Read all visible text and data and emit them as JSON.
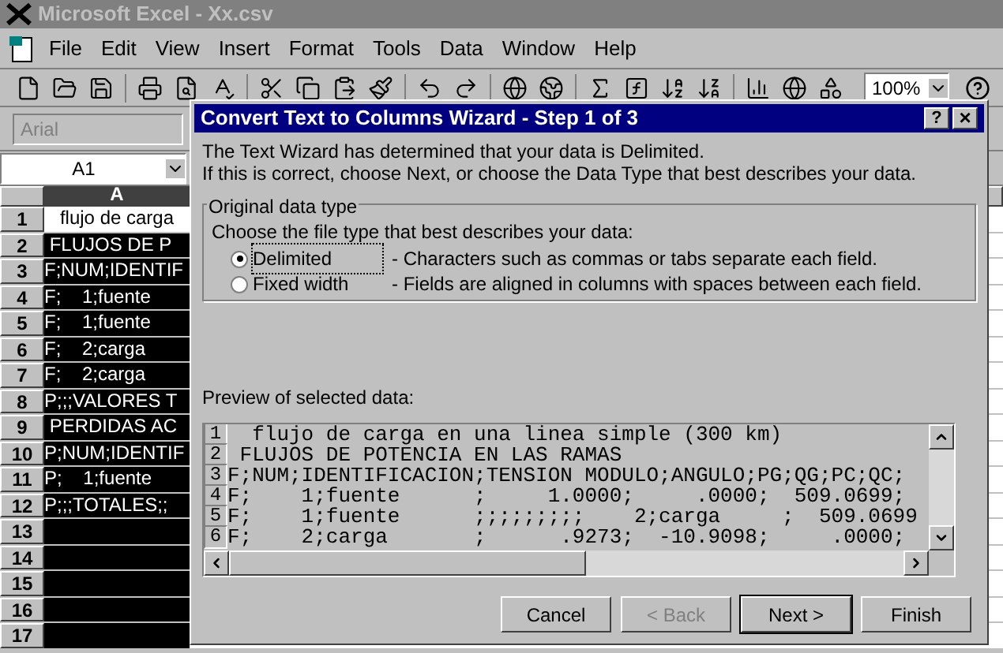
{
  "window": {
    "title": "Microsoft Excel - Xx.csv",
    "active": false
  },
  "menu": [
    "File",
    "Edit",
    "View",
    "Insert",
    "Format",
    "Tools",
    "Data",
    "Window",
    "Help"
  ],
  "toolbar": {
    "zoom": "100%"
  },
  "format_toolbar": {
    "font": "Arial"
  },
  "formula_bar": {
    "name_box": "A1"
  },
  "sheet": {
    "columns": [
      {
        "label": "A",
        "selected": true
      }
    ],
    "rows": [
      {
        "number": "1",
        "cell": "flujo de carga",
        "active": true
      },
      {
        "number": "2",
        "cell": " FLUJOS DE P",
        "active": false
      },
      {
        "number": "3",
        "cell": "F;NUM;IDENTIF",
        "active": false
      },
      {
        "number": "4",
        "cell": "F;    1;fuente",
        "active": false
      },
      {
        "number": "5",
        "cell": "F;    1;fuente",
        "active": false
      },
      {
        "number": "6",
        "cell": "F;    2;carga",
        "active": false
      },
      {
        "number": "7",
        "cell": "F;    2;carga",
        "active": false
      },
      {
        "number": "8",
        "cell": "P;;;VALORES T",
        "active": false
      },
      {
        "number": "9",
        "cell": " PERDIDAS AC",
        "active": false
      },
      {
        "number": "10",
        "cell": "P;NUM;IDENTIF",
        "active": false
      },
      {
        "number": "11",
        "cell": "P;    1;fuente",
        "active": false
      },
      {
        "number": "12",
        "cell": "P;;;TOTALES;;",
        "active": false
      },
      {
        "number": "13",
        "cell": "",
        "active": false
      },
      {
        "number": "14",
        "cell": "",
        "active": false
      },
      {
        "number": "15",
        "cell": "",
        "active": false
      },
      {
        "number": "16",
        "cell": "",
        "active": false
      },
      {
        "number": "17",
        "cell": "",
        "active": false
      }
    ]
  },
  "dialog": {
    "title": "Convert Text to Columns Wizard - Step 1 of 3",
    "help": "?",
    "close": "×",
    "intro": [
      "The Text Wizard has determined that your data is Delimited.",
      "If this is correct, choose Next, or choose the Data Type that best describes your data."
    ],
    "group": {
      "legend": "Original data type",
      "prompt": "Choose the file type that best describes your data:",
      "options": [
        {
          "label": "Delimited",
          "description": "- Characters such as commas or tabs separate each field.",
          "selected": true
        },
        {
          "label": "Fixed width",
          "description": "- Fields are aligned in columns with spaces between each field.",
          "selected": false
        }
      ]
    },
    "preview": {
      "label": "Preview of selected data:",
      "lines": [
        {
          "number": "1",
          "text": "  flujo de carga en una linea simple (300 km)"
        },
        {
          "number": "2",
          "text": " FLUJOS DE POTENCIA EN LAS RAMAS"
        },
        {
          "number": "3",
          "text": "F;NUM;IDENTIFICACION;TENSION MODULO;ANGULO;PG;QG;PC;QC;"
        },
        {
          "number": "4",
          "text": "F;    1;fuente      ;     1.0000;     .0000;  509.0699;"
        },
        {
          "number": "5",
          "text": "F;    1;fuente      ;;;;;;;;;    2;carga     ;  509.0699"
        },
        {
          "number": "6",
          "text": "F;    2;carga       ;      .9273;  -10.9098;     .0000;"
        }
      ]
    },
    "buttons": [
      {
        "label": "Cancel",
        "disabled": false,
        "default": false
      },
      {
        "label": "< Back",
        "disabled": true,
        "default": false
      },
      {
        "label": "Next >",
        "disabled": false,
        "default": true
      },
      {
        "label": "Finish",
        "disabled": false,
        "default": false
      }
    ]
  }
}
